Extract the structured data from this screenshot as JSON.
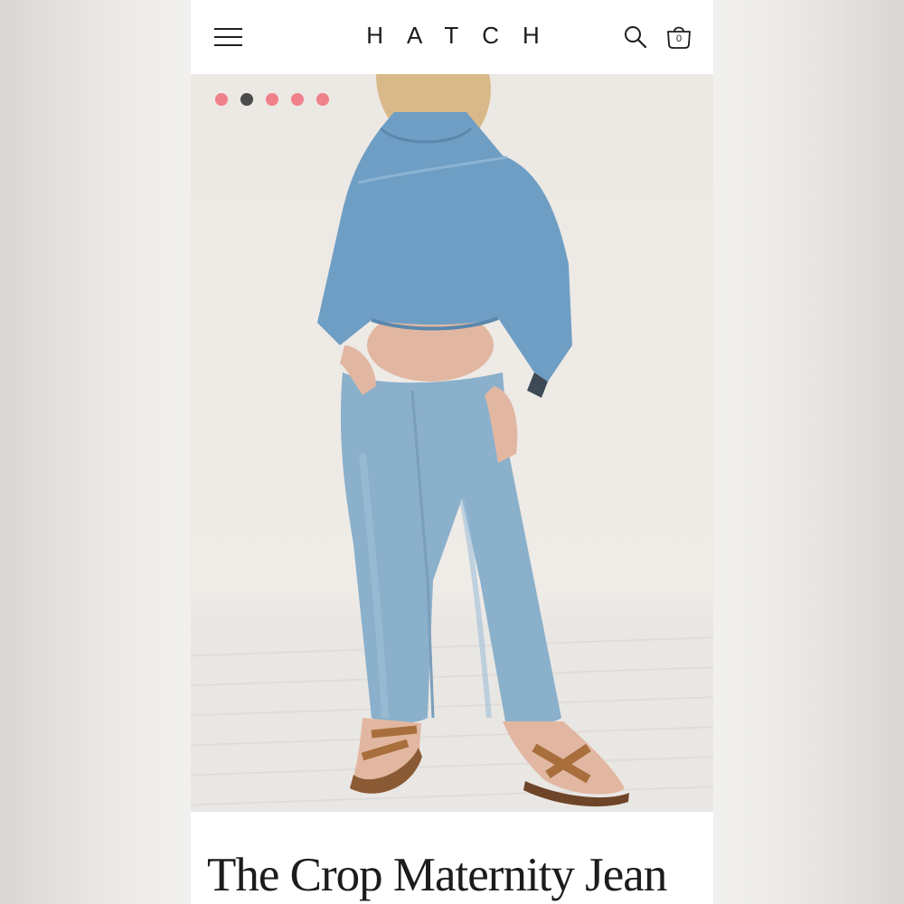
{
  "header": {
    "brand": "HATCH",
    "menu_icon": "hamburger-menu-icon",
    "search_icon": "search-icon",
    "bag_icon": "shopping-bag-icon",
    "bag_count": "0"
  },
  "gallery": {
    "slide_count": 5,
    "active_index": 1,
    "colors": {
      "dot": "#f0808a",
      "dot_active": "#4a4a4a"
    }
  },
  "product": {
    "title": "The Crop Maternity Jean"
  }
}
